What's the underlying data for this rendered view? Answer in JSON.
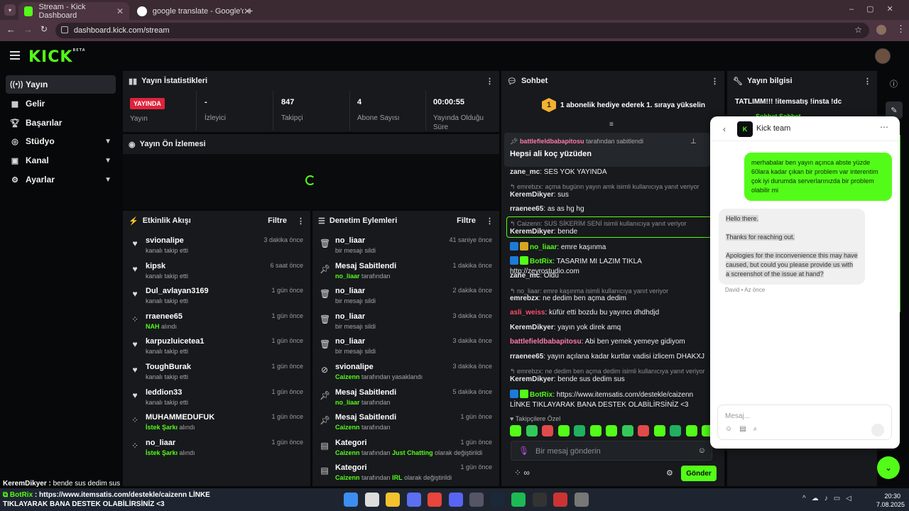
{
  "browser": {
    "tabs": [
      {
        "title": "Stream - Kick Dashboard",
        "active": true
      },
      {
        "title": "google translate - Google'da A",
        "active": false
      }
    ],
    "url": "dashboard.kick.com/stream"
  },
  "logo": {
    "text": "KICK",
    "beta": "BETA"
  },
  "sidebar": {
    "items": [
      {
        "label": "Yayın",
        "icon": "broadcast-icon",
        "active": true
      },
      {
        "label": "Gelir",
        "icon": "revenue-icon"
      },
      {
        "label": "Başarılar",
        "icon": "trophy-icon"
      },
      {
        "label": "Stüdyo",
        "icon": "studio-icon",
        "expandable": true
      },
      {
        "label": "Kanal",
        "icon": "channel-icon",
        "expandable": true
      },
      {
        "label": "Ayarlar",
        "icon": "gear-icon",
        "expandable": true
      }
    ]
  },
  "stats": {
    "title": "Yayın İstatistikleri",
    "live_badge": "YAYINDA",
    "live_label": "Yayın",
    "items": [
      {
        "value": "-",
        "label": "İzleyici"
      },
      {
        "value": "847",
        "label": "Takipçi"
      },
      {
        "value": "4",
        "label": "Abone Sayısı"
      },
      {
        "value": "00:00:55",
        "label": "Yayında Olduğu Süre"
      }
    ]
  },
  "preview": {
    "title": "Yayın Ön İzlemesi"
  },
  "activity": {
    "title": "Etkinlik Akışı",
    "filter": "Filtre",
    "items": [
      {
        "name": "svionalipe",
        "desc": "kanalı takip etti",
        "time": "3 dakika önce",
        "icon": "heart-icon"
      },
      {
        "name": "kipsk",
        "desc": "kanalı takip etti",
        "time": "6 saat önce",
        "icon": "heart-icon"
      },
      {
        "name": "Dul_avlayan3169",
        "desc": "kanalı takip etti",
        "time": "1 gün önce",
        "icon": "heart-icon"
      },
      {
        "name": "rraenee65",
        "hl": "NAH",
        "desc": "alındı",
        "time": "1 gün önce",
        "icon": "reward-icon"
      },
      {
        "name": "karpuzluicetea1",
        "desc": "kanalı takip etti",
        "time": "1 gün önce",
        "icon": "heart-icon"
      },
      {
        "name": "ToughBurak",
        "desc": "kanalı takip etti",
        "time": "1 gün önce",
        "icon": "heart-icon"
      },
      {
        "name": "leddion33",
        "desc": "kanalı takip etti",
        "time": "1 gün önce",
        "icon": "heart-icon"
      },
      {
        "name": "MUHAMMEDUFUK",
        "hl": "İstek Şarkı",
        "desc": "alındı",
        "time": "1 gün önce",
        "icon": "reward-icon"
      },
      {
        "name": "no_liaar",
        "hl": "İstek Şarkı",
        "desc": "alındı",
        "time": "1 gün önce",
        "icon": "reward-icon"
      }
    ]
  },
  "moderation": {
    "title": "Denetim Eylemleri",
    "filter": "Filtre",
    "items": [
      {
        "name": "no_liaar",
        "desc": "bir mesajı sildi",
        "time": "41 saniye önce",
        "icon": "trash-icon"
      },
      {
        "name": "Mesaj Sabitlendi",
        "hl": "no_liaar",
        "desc": "tarafından",
        "time": "1 dakika önce",
        "icon": "pin-icon"
      },
      {
        "name": "no_liaar",
        "desc": "bir mesajı sildi",
        "time": "2 dakika önce",
        "icon": "trash-icon"
      },
      {
        "name": "no_liaar",
        "desc": "bir mesajı sildi",
        "time": "3 dakika önce",
        "icon": "trash-icon"
      },
      {
        "name": "no_liaar",
        "desc": "bir mesajı sildi",
        "time": "3 dakika önce",
        "icon": "trash-icon"
      },
      {
        "name": "svionalipe",
        "hl": "Caizenn",
        "desc": "tarafından yasaklandı",
        "time": "3 dakika önce",
        "icon": "ban-icon"
      },
      {
        "name": "Mesaj Sabitlendi",
        "hl": "no_liaar",
        "desc": "tarafından",
        "time": "5 dakika önce",
        "icon": "pin-icon"
      },
      {
        "name": "Mesaj Sabitlendi",
        "hl": "Caizenn",
        "desc": "tarafından",
        "time": "1 gün önce",
        "icon": "pin-icon"
      },
      {
        "name": "Kategori",
        "hl": "Caizenn",
        "desc": "tarafından",
        "hl2": "Just Chatting",
        "desc2": "olarak değiştirildi",
        "time": "1 gün önce",
        "icon": "category-icon"
      },
      {
        "name": "Kategori",
        "hl": "Caizenn",
        "desc": "tarafından",
        "hl2": "IRL",
        "desc2": "olarak değiştirildi",
        "time": "1 gün önce",
        "icon": "category-icon"
      }
    ]
  },
  "chat": {
    "title": "Sohbet",
    "goal_rank": "1",
    "goal_text": "1 abonelik hediye ederek 1. sıraya yükselin",
    "pinned_by": "battlefieldbabapitosu",
    "pinned_suffix": "tarafından sabitlendi",
    "pinned_msg": "Hepsi ali koç yüzüden",
    "messages": [
      {
        "user": "zane_mc",
        "color": "#e8e8e8",
        "text": "SES YOK YAYINDA"
      },
      {
        "reply": "emrebzx: açma bugünn yayın amk isimli kullanıcıya yanıt veriyor"
      },
      {
        "user": "KeremDikyer",
        "color": "#e8e8e8",
        "text": "sus"
      },
      {
        "user": "rraenee65",
        "color": "#e8e8e8",
        "text": "as as hg hg"
      },
      {
        "reply": "Caizenn: SUS SİKERİM SENİ isimli kullanıcıya yanıt veriyor"
      },
      {
        "user": "KeremDikyer",
        "color": "#e8e8e8",
        "text": "bende"
      },
      {
        "user": "no_liaar",
        "color": "#53fc18",
        "text": "emre kaşınma",
        "badges": 2
      },
      {
        "user": "BotRix",
        "color": "#53fc18",
        "text": "TASARIM MI LAZIM TIKLA http://zeyrostudio.com",
        "badges": 2
      },
      {
        "user": "zane_mc",
        "color": "#e8e8e8",
        "text": "Oldu"
      },
      {
        "reply": "no_liaar: emre kaşınma isimli kullanıcıya yanıt veriyor"
      },
      {
        "user": "emrebzx",
        "color": "#e8e8e8",
        "text": "ne dedim ben açma dedim"
      },
      {
        "user": "asli_weiss",
        "color": "#ff4d6a",
        "text": "küfür etti bozdu bu yayıncı dhdhdjd"
      },
      {
        "user": "KeremDikyer",
        "color": "#e8e8e8",
        "text": "yayın yok direk amq"
      },
      {
        "user": "battlefieldbabapitosu",
        "color": "#ff7aa8",
        "text": "Abi ben yemek yemeye gidiyom"
      },
      {
        "user": "rraenee65",
        "color": "#e8e8e8",
        "text": "yayın açılana kadar kurtlar vadisi izlicem DHAKXJ"
      },
      {
        "reply": "emrebzx: ne dedim ben açma dedim isimli kullanıcıya yanıt veriyor"
      },
      {
        "user": "KeremDikyer",
        "color": "#e8e8e8",
        "text": "bende sus dedim sus"
      },
      {
        "user": "BotRix",
        "color": "#53fc18",
        "text": "https://www.itemsatis.com/destekle/caizenn LİNKE TIKLAYARAK BANA DESTEK OLABİLİRSİNİZ <3",
        "badges": 2
      }
    ],
    "followers_only": "Takipçilere Özel",
    "input_placeholder": "Bir mesaj gönderin",
    "send": "Gönder",
    "infinity": "∞"
  },
  "stream_info": {
    "title": "Yayın bilgisi",
    "stream_title": "TATLIMM!!! !itemsatış !insta !dc",
    "category": "Sohbet Sohbet"
  },
  "support": {
    "title": "Kick team",
    "user_msg": "merhabalar ben yayın açınca abste yüzde 60lara kadar çıkan bir problem var interentim çok iyi durumda serverlarınızda bir problem olabilir mi",
    "agent_lines": [
      "Hello there.",
      "Thanks for reaching out.",
      "Apologies for the inconvenience this may have caused, but could you please provide us with a screenshot of the issue at hand?"
    ],
    "agent_meta": "David • Az önce",
    "input_placeholder": "Mesaj..."
  },
  "overlay": {
    "line1_user": "KeremDikyer",
    "line1_text": "bende sus dedim sus",
    "line2_user": "BotRix",
    "line2_text": "https://www.itemsatis.com/destekle/caizenn LİNKE TIKLAYARAK BANA DESTEK OLABİLİRSİNİZ <3"
  },
  "taskbar": {
    "time": "20:30",
    "date": "7.08.2025"
  }
}
